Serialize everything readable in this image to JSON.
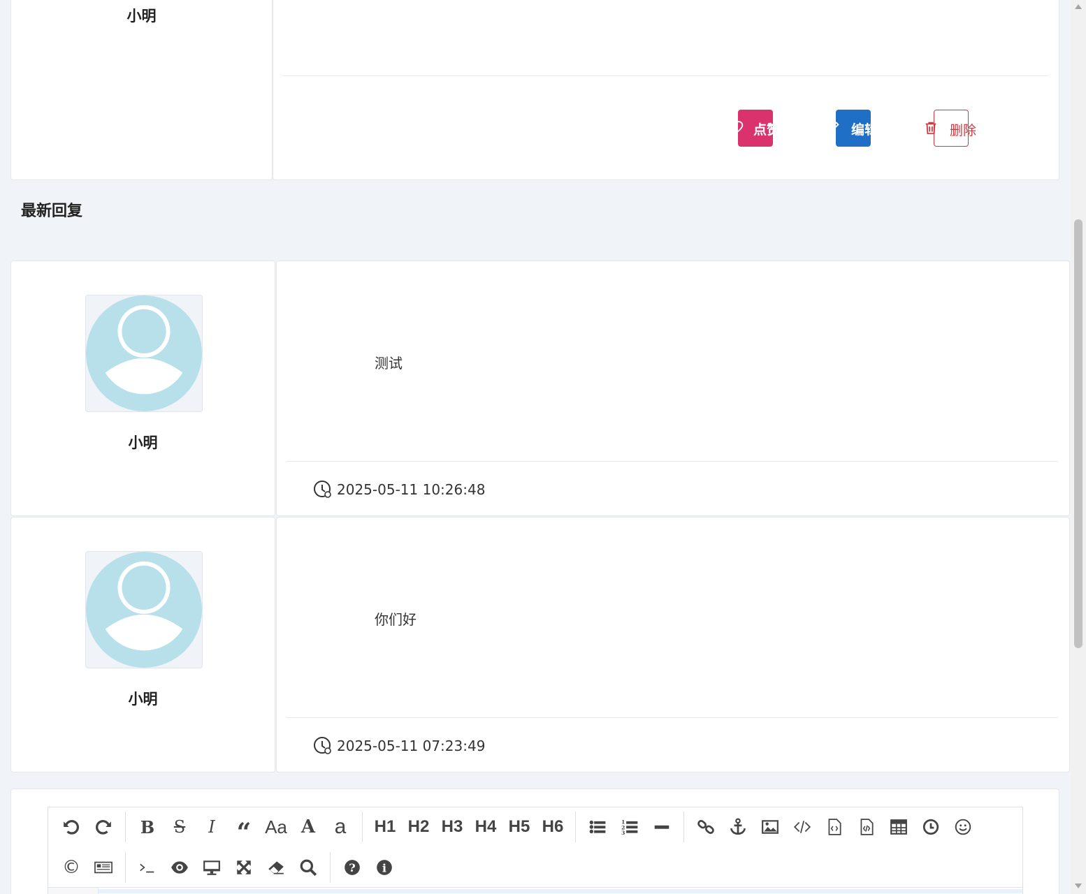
{
  "top_post": {
    "author_name": "小明",
    "actions": {
      "like_label": "点赞",
      "edit_label": "编辑",
      "delete_label": "删除"
    },
    "colors": {
      "like": "#d9326c",
      "edit": "#1f6fc6",
      "delete": "#d9363e"
    }
  },
  "section_title": "最新回复",
  "replies": [
    {
      "author_name": "小明",
      "content": "测试",
      "time": "2025-05-11 10:26:48",
      "avatar_icon": "default-user-avatar"
    },
    {
      "author_name": "小明",
      "content": "你们好",
      "time": "2025-05-11 07:23:49",
      "avatar_icon": "default-user-avatar"
    }
  ],
  "editor": {
    "toolbar_row1": [
      "undo-icon",
      "redo-icon",
      "bold-icon",
      "strikethrough-icon",
      "italic-icon",
      "quote-icon",
      "case-uppercase-icon",
      "case-lowercase-icon",
      "text-a-icon",
      "H1",
      "H2",
      "H3",
      "H4",
      "H5",
      "H6",
      "list-ul-icon",
      "list-ol-icon",
      "hr-icon",
      "link-icon",
      "anchor-icon",
      "image-icon",
      "code-icon",
      "preformatted-code-icon",
      "code-block-icon",
      "table-icon",
      "datetime-icon",
      "emoji-icon"
    ],
    "toolbar_row2": [
      "html-entities-icon",
      "pagebreak-icon",
      "goto-line-icon",
      "watch-icon",
      "preview-icon",
      "fullscreen-icon",
      "clear-icon",
      "search-icon",
      "help-icon",
      "info-icon"
    ],
    "headings": {
      "h1": "H1",
      "h2": "H2",
      "h3": "H3",
      "h4": "H4",
      "h5": "H5",
      "h6": "H6"
    },
    "case_label": "Aa"
  }
}
